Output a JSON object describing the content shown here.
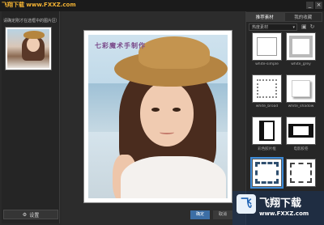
{
  "titlebar": {
    "watermark": "飞翔下载 www.FXXZ.com",
    "buttons": [
      "_",
      "×"
    ]
  },
  "left_panel": {
    "hint": "请确定刚才在选框中的图片区域",
    "settings_label": "设置",
    "settings_icon": "gear-icon"
  },
  "canvas": {
    "photo_caption": "七彩魔术手制作"
  },
  "footer": {
    "confirm_label": "确定",
    "cancel_label": "取消"
  },
  "right_panel": {
    "tabs": [
      "推荐素材",
      "我的收藏"
    ],
    "active_tab": 0,
    "filter_value": "热度素材",
    "frames": [
      {
        "label": "white-simple"
      },
      {
        "label": "white_grey"
      },
      {
        "label": "white_broad"
      },
      {
        "label": "white_shadow"
      },
      {
        "label": "彩色胶片框"
      },
      {
        "label": "电影胶卷"
      },
      {
        "label": ""
      },
      {
        "label": ""
      }
    ],
    "selected_frame": 6
  },
  "logo": {
    "mark": "飞",
    "text": "飞翔下载",
    "url": "www.FXXZ.com"
  },
  "colors": {
    "accent": "#3d8ad6",
    "confirm": "#3c6ea5",
    "watermark": "#f2b233"
  }
}
